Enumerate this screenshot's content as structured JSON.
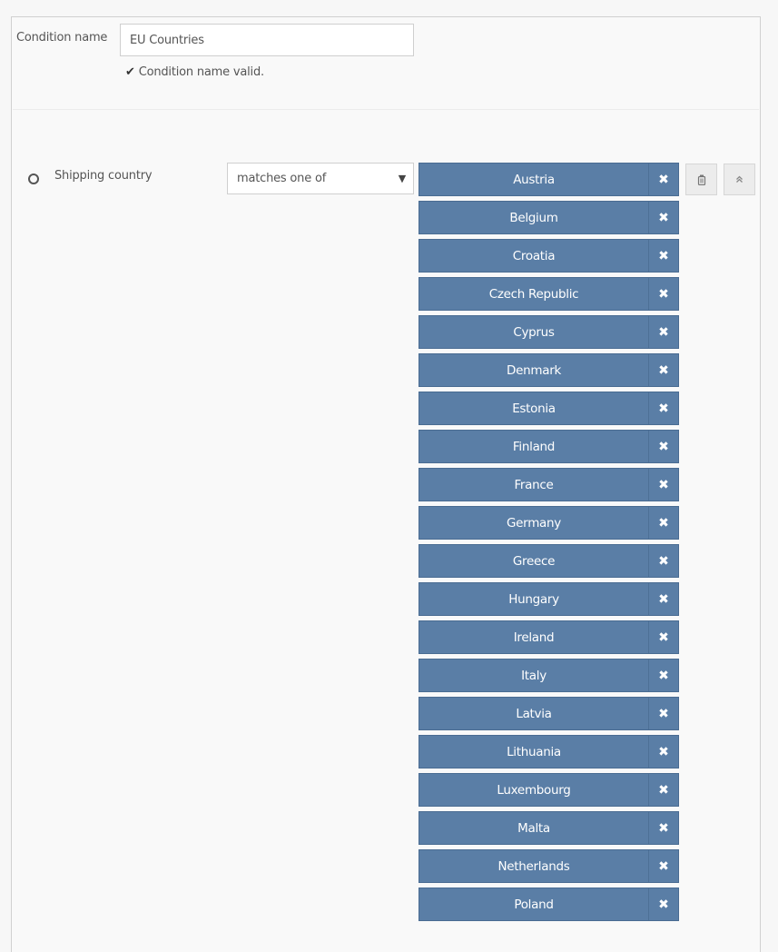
{
  "condition": {
    "name_label": "Condition name",
    "name_value": "EU Countries",
    "validation_icon": "check-icon",
    "validation_message": "Condition name valid."
  },
  "rule": {
    "field_icon": "radio-circle-icon",
    "field_label": "Shipping country",
    "operator": {
      "selected": "matches one of",
      "icon": "caret-down-icon"
    },
    "remove_icon_glyph": "✖",
    "countries": [
      {
        "name": "Austria"
      },
      {
        "name": "Belgium"
      },
      {
        "name": "Croatia"
      },
      {
        "name": "Czech Republic"
      },
      {
        "name": "Cyprus"
      },
      {
        "name": "Denmark"
      },
      {
        "name": "Estonia"
      },
      {
        "name": "Finland"
      },
      {
        "name": "France"
      },
      {
        "name": "Germany"
      },
      {
        "name": "Greece"
      },
      {
        "name": "Hungary"
      },
      {
        "name": "Ireland"
      },
      {
        "name": "Italy"
      },
      {
        "name": "Latvia"
      },
      {
        "name": "Lithuania"
      },
      {
        "name": "Luxembourg"
      },
      {
        "name": "Malta"
      },
      {
        "name": "Netherlands"
      },
      {
        "name": "Poland"
      }
    ],
    "actions": {
      "delete_icon": "trash-icon",
      "collapse_icon": "double-chevron-up-icon"
    }
  },
  "colors": {
    "tag_background": "#5a7ea6",
    "tag_text": "#ffffff",
    "panel_background": "#f9f9f9"
  }
}
